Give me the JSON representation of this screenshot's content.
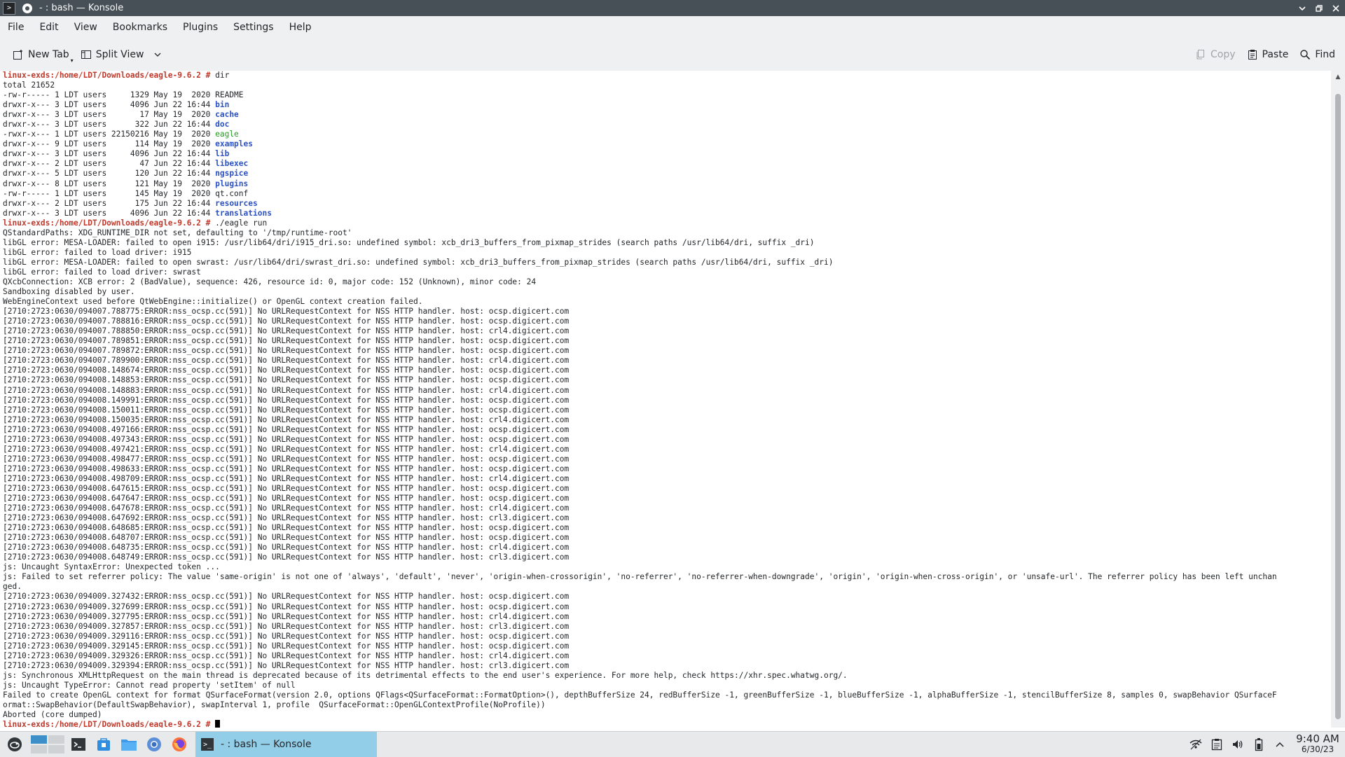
{
  "window": {
    "title": "- : bash — Konsole"
  },
  "menu": [
    "File",
    "Edit",
    "View",
    "Bookmarks",
    "Plugins",
    "Settings",
    "Help"
  ],
  "toolbar": {
    "new_tab": "New Tab",
    "split_view": "Split View",
    "copy": "Copy",
    "paste": "Paste",
    "find": "Find"
  },
  "terminal": {
    "lines": [
      [
        {
          "t": "linux-exds:/home/LDT/Downloads/eagle-9.6.2 #",
          "c": "prompt"
        },
        {
          "t": " dir"
        }
      ],
      [
        {
          "t": "total 21652"
        }
      ],
      [
        {
          "t": "-rw-r----- 1 LDT users     1329 May 19  2020 README"
        }
      ],
      [
        {
          "t": "drwxr-x--- 3 LDT users     4096 Jun 22 16:44 "
        },
        {
          "t": "bin",
          "c": "dir"
        }
      ],
      [
        {
          "t": "drwxr-x--- 3 LDT users       17 May 19  2020 "
        },
        {
          "t": "cache",
          "c": "dir"
        }
      ],
      [
        {
          "t": "drwxr-x--- 3 LDT users      322 Jun 22 16:44 "
        },
        {
          "t": "doc",
          "c": "dir"
        }
      ],
      [
        {
          "t": "-rwxr-x--- 1 LDT users 22150216 May 19  2020 "
        },
        {
          "t": "eagle",
          "c": "exe"
        }
      ],
      [
        {
          "t": "drwxr-x--- 9 LDT users      114 May 19  2020 "
        },
        {
          "t": "examples",
          "c": "dir"
        }
      ],
      [
        {
          "t": "drwxr-x--- 3 LDT users     4096 Jun 22 16:44 "
        },
        {
          "t": "lib",
          "c": "dir"
        }
      ],
      [
        {
          "t": "drwxr-x--- 2 LDT users       47 Jun 22 16:44 "
        },
        {
          "t": "libexec",
          "c": "dir"
        }
      ],
      [
        {
          "t": "drwxr-x--- 5 LDT users      120 Jun 22 16:44 "
        },
        {
          "t": "ngspice",
          "c": "dir"
        }
      ],
      [
        {
          "t": "drwxr-x--- 8 LDT users      121 May 19  2020 "
        },
        {
          "t": "plugins",
          "c": "dir"
        }
      ],
      [
        {
          "t": "-rw-r----- 1 LDT users      145 May 19  2020 qt.conf"
        }
      ],
      [
        {
          "t": "drwxr-x--- 2 LDT users      175 Jun 22 16:44 "
        },
        {
          "t": "resources",
          "c": "dir"
        }
      ],
      [
        {
          "t": "drwxr-x--- 3 LDT users     4096 Jun 22 16:44 "
        },
        {
          "t": "translations",
          "c": "dir"
        }
      ],
      [
        {
          "t": "linux-exds:/home/LDT/Downloads/eagle-9.6.2 #",
          "c": "prompt"
        },
        {
          "t": " ./eagle run"
        }
      ],
      [
        {
          "t": "QStandardPaths: XDG_RUNTIME_DIR not set, defaulting to '/tmp/runtime-root'"
        }
      ],
      [
        {
          "t": "libGL error: MESA-LOADER: failed to open i915: /usr/lib64/dri/i915_dri.so: undefined symbol: xcb_dri3_buffers_from_pixmap_strides (search paths /usr/lib64/dri, suffix _dri)"
        }
      ],
      [
        {
          "t": "libGL error: failed to load driver: i915"
        }
      ],
      [
        {
          "t": "libGL error: MESA-LOADER: failed to open swrast: /usr/lib64/dri/swrast_dri.so: undefined symbol: xcb_dri3_buffers_from_pixmap_strides (search paths /usr/lib64/dri, suffix _dri)"
        }
      ],
      [
        {
          "t": "libGL error: failed to load driver: swrast"
        }
      ],
      [
        {
          "t": "QXcbConnection: XCB error: 2 (BadValue), sequence: 426, resource id: 0, major code: 152 (Unknown), minor code: 24"
        }
      ],
      [
        {
          "t": "Sandboxing disabled by user."
        }
      ],
      [
        {
          "t": "WebEngineContext used before QtWebEngine::initialize() or OpenGL context creation failed."
        }
      ],
      [
        {
          "t": "[2710:2723:0630/094007.788775:ERROR:nss_ocsp.cc(591)] No URLRequestContext for NSS HTTP handler. host: ocsp.digicert.com"
        }
      ],
      [
        {
          "t": "[2710:2723:0630/094007.788816:ERROR:nss_ocsp.cc(591)] No URLRequestContext for NSS HTTP handler. host: ocsp.digicert.com"
        }
      ],
      [
        {
          "t": "[2710:2723:0630/094007.788850:ERROR:nss_ocsp.cc(591)] No URLRequestContext for NSS HTTP handler. host: crl4.digicert.com"
        }
      ],
      [
        {
          "t": "[2710:2723:0630/094007.789851:ERROR:nss_ocsp.cc(591)] No URLRequestContext for NSS HTTP handler. host: ocsp.digicert.com"
        }
      ],
      [
        {
          "t": "[2710:2723:0630/094007.789872:ERROR:nss_ocsp.cc(591)] No URLRequestContext for NSS HTTP handler. host: ocsp.digicert.com"
        }
      ],
      [
        {
          "t": "[2710:2723:0630/094007.789900:ERROR:nss_ocsp.cc(591)] No URLRequestContext for NSS HTTP handler. host: crl4.digicert.com"
        }
      ],
      [
        {
          "t": "[2710:2723:0630/094008.148674:ERROR:nss_ocsp.cc(591)] No URLRequestContext for NSS HTTP handler. host: ocsp.digicert.com"
        }
      ],
      [
        {
          "t": "[2710:2723:0630/094008.148853:ERROR:nss_ocsp.cc(591)] No URLRequestContext for NSS HTTP handler. host: ocsp.digicert.com"
        }
      ],
      [
        {
          "t": "[2710:2723:0630/094008.148883:ERROR:nss_ocsp.cc(591)] No URLRequestContext for NSS HTTP handler. host: crl4.digicert.com"
        }
      ],
      [
        {
          "t": "[2710:2723:0630/094008.149991:ERROR:nss_ocsp.cc(591)] No URLRequestContext for NSS HTTP handler. host: ocsp.digicert.com"
        }
      ],
      [
        {
          "t": "[2710:2723:0630/094008.150011:ERROR:nss_ocsp.cc(591)] No URLRequestContext for NSS HTTP handler. host: ocsp.digicert.com"
        }
      ],
      [
        {
          "t": "[2710:2723:0630/094008.150035:ERROR:nss_ocsp.cc(591)] No URLRequestContext for NSS HTTP handler. host: crl4.digicert.com"
        }
      ],
      [
        {
          "t": "[2710:2723:0630/094008.497166:ERROR:nss_ocsp.cc(591)] No URLRequestContext for NSS HTTP handler. host: ocsp.digicert.com"
        }
      ],
      [
        {
          "t": "[2710:2723:0630/094008.497343:ERROR:nss_ocsp.cc(591)] No URLRequestContext for NSS HTTP handler. host: ocsp.digicert.com"
        }
      ],
      [
        {
          "t": "[2710:2723:0630/094008.497421:ERROR:nss_ocsp.cc(591)] No URLRequestContext for NSS HTTP handler. host: crl4.digicert.com"
        }
      ],
      [
        {
          "t": "[2710:2723:0630/094008.498477:ERROR:nss_ocsp.cc(591)] No URLRequestContext for NSS HTTP handler. host: ocsp.digicert.com"
        }
      ],
      [
        {
          "t": "[2710:2723:0630/094008.498633:ERROR:nss_ocsp.cc(591)] No URLRequestContext for NSS HTTP handler. host: ocsp.digicert.com"
        }
      ],
      [
        {
          "t": "[2710:2723:0630/094008.498709:ERROR:nss_ocsp.cc(591)] No URLRequestContext for NSS HTTP handler. host: crl4.digicert.com"
        }
      ],
      [
        {
          "t": "[2710:2723:0630/094008.647615:ERROR:nss_ocsp.cc(591)] No URLRequestContext for NSS HTTP handler. host: ocsp.digicert.com"
        }
      ],
      [
        {
          "t": "[2710:2723:0630/094008.647647:ERROR:nss_ocsp.cc(591)] No URLRequestContext for NSS HTTP handler. host: ocsp.digicert.com"
        }
      ],
      [
        {
          "t": "[2710:2723:0630/094008.647678:ERROR:nss_ocsp.cc(591)] No URLRequestContext for NSS HTTP handler. host: crl4.digicert.com"
        }
      ],
      [
        {
          "t": "[2710:2723:0630/094008.647692:ERROR:nss_ocsp.cc(591)] No URLRequestContext for NSS HTTP handler. host: crl3.digicert.com"
        }
      ],
      [
        {
          "t": "[2710:2723:0630/094008.648685:ERROR:nss_ocsp.cc(591)] No URLRequestContext for NSS HTTP handler. host: ocsp.digicert.com"
        }
      ],
      [
        {
          "t": "[2710:2723:0630/094008.648707:ERROR:nss_ocsp.cc(591)] No URLRequestContext for NSS HTTP handler. host: ocsp.digicert.com"
        }
      ],
      [
        {
          "t": "[2710:2723:0630/094008.648735:ERROR:nss_ocsp.cc(591)] No URLRequestContext for NSS HTTP handler. host: crl4.digicert.com"
        }
      ],
      [
        {
          "t": "[2710:2723:0630/094008.648749:ERROR:nss_ocsp.cc(591)] No URLRequestContext for NSS HTTP handler. host: crl3.digicert.com"
        }
      ],
      [
        {
          "t": "js: Uncaught SyntaxError: Unexpected token ..."
        }
      ],
      [
        {
          "t": "js: Failed to set referrer policy: The value 'same-origin' is not one of 'always', 'default', 'never', 'origin-when-crossorigin', 'no-referrer', 'no-referrer-when-downgrade', 'origin', 'origin-when-cross-origin', or 'unsafe-url'. The referrer policy has been left unchan"
        }
      ],
      [
        {
          "t": "ged."
        }
      ],
      [
        {
          "t": "[2710:2723:0630/094009.327432:ERROR:nss_ocsp.cc(591)] No URLRequestContext for NSS HTTP handler. host: ocsp.digicert.com"
        }
      ],
      [
        {
          "t": "[2710:2723:0630/094009.327699:ERROR:nss_ocsp.cc(591)] No URLRequestContext for NSS HTTP handler. host: ocsp.digicert.com"
        }
      ],
      [
        {
          "t": "[2710:2723:0630/094009.327795:ERROR:nss_ocsp.cc(591)] No URLRequestContext for NSS HTTP handler. host: crl4.digicert.com"
        }
      ],
      [
        {
          "t": "[2710:2723:0630/094009.327857:ERROR:nss_ocsp.cc(591)] No URLRequestContext for NSS HTTP handler. host: crl3.digicert.com"
        }
      ],
      [
        {
          "t": "[2710:2723:0630/094009.329116:ERROR:nss_ocsp.cc(591)] No URLRequestContext for NSS HTTP handler. host: ocsp.digicert.com"
        }
      ],
      [
        {
          "t": "[2710:2723:0630/094009.329145:ERROR:nss_ocsp.cc(591)] No URLRequestContext for NSS HTTP handler. host: ocsp.digicert.com"
        }
      ],
      [
        {
          "t": "[2710:2723:0630/094009.329326:ERROR:nss_ocsp.cc(591)] No URLRequestContext for NSS HTTP handler. host: crl4.digicert.com"
        }
      ],
      [
        {
          "t": "[2710:2723:0630/094009.329394:ERROR:nss_ocsp.cc(591)] No URLRequestContext for NSS HTTP handler. host: crl3.digicert.com"
        }
      ],
      [
        {
          "t": "js: Synchronous XMLHttpRequest on the main thread is deprecated because of its detrimental effects to the end user's experience. For more help, check https://xhr.spec.whatwg.org/."
        }
      ],
      [
        {
          "t": "js: Uncaught TypeError: Cannot read property 'setItem' of null"
        }
      ],
      [
        {
          "t": "Failed to create OpenGL context for format QSurfaceFormat(version 2.0, options QFlags<QSurfaceFormat::FormatOption>(), depthBufferSize 24, redBufferSize -1, greenBufferSize -1, blueBufferSize -1, alphaBufferSize -1, stencilBufferSize 8, samples 0, swapBehavior QSurfaceF"
        }
      ],
      [
        {
          "t": "ormat::SwapBehavior(DefaultSwapBehavior), swapInterval 1, profile  QSurfaceFormat::OpenGLContextProfile(NoProfile))"
        }
      ],
      [
        {
          "t": "Aborted (core dumped)"
        }
      ],
      [
        {
          "t": "linux-exds:/home/LDT/Downloads/eagle-9.6.2 #",
          "c": "prompt"
        },
        {
          "t": " "
        },
        {
          "cursor": true
        }
      ]
    ]
  },
  "taskbar": {
    "active_task": "- : bash — Konsole",
    "time": "9:40 AM",
    "date": "6/30/23"
  },
  "icons": {
    "window": "konsole-icon",
    "new_tab": "new-tab-icon",
    "split_view": "split-view-icon",
    "copy": "copy-icon",
    "paste": "paste-icon",
    "find": "search-icon",
    "taskbar": [
      "app-launcher-icon",
      "virtual-desktops-icon",
      "terminal-icon",
      "store-icon",
      "file-manager-icon",
      "chromium-icon",
      "firefox-icon"
    ],
    "tray": [
      "network-icon",
      "clipboard-icon",
      "volume-icon",
      "battery-icon",
      "tray-expand-icon"
    ]
  }
}
